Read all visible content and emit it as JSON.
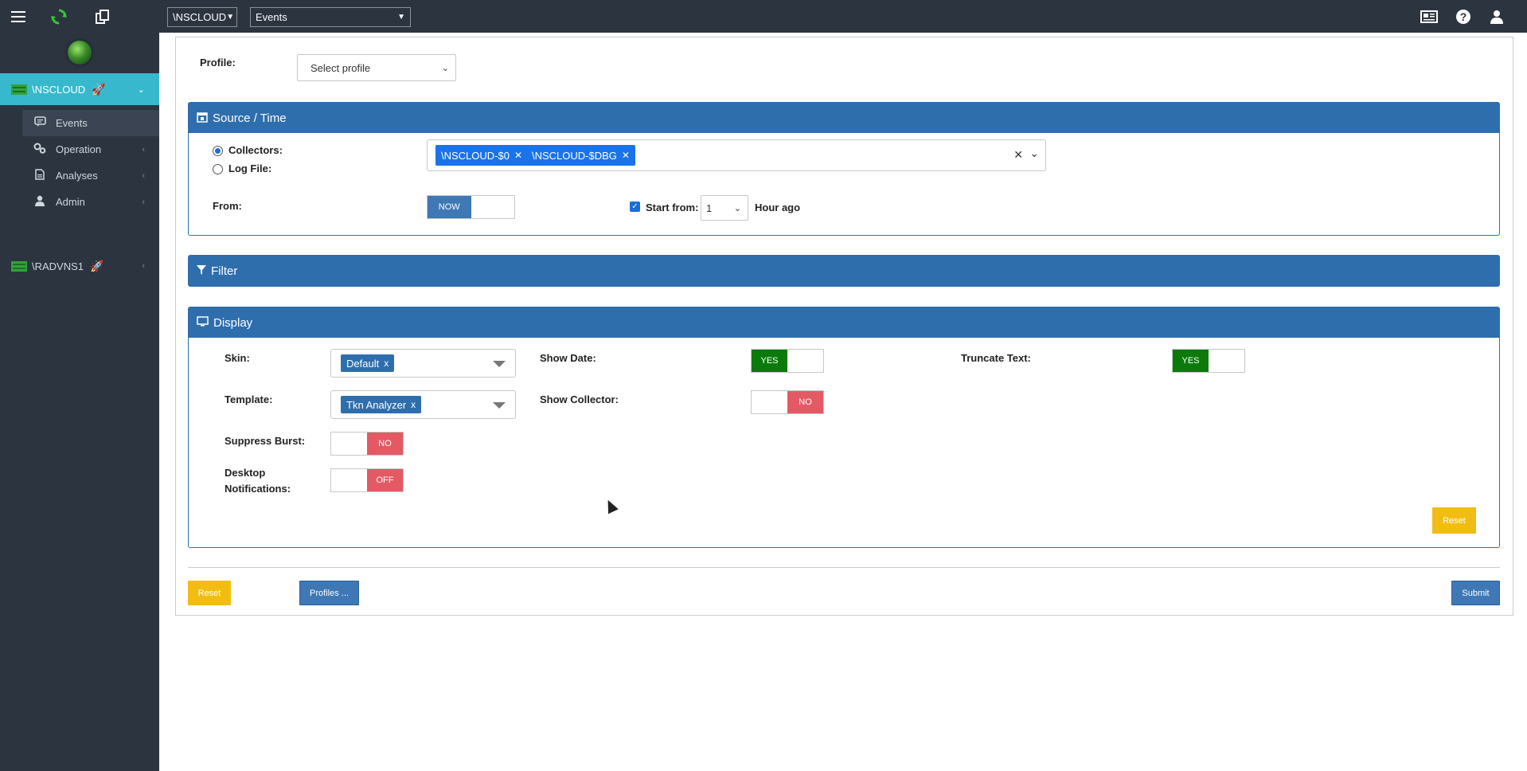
{
  "topbar": {
    "menu_icon": "hamburger-icon",
    "refresh_icon": "refresh-icon",
    "copy_icon": "copy-icon",
    "node_select": "\\NSCLOUD",
    "page_select": "Events",
    "news_icon": "newspaper-icon",
    "help_icon": "help-icon",
    "user_icon": "user-icon"
  },
  "sidebar": {
    "nodes": [
      {
        "label": "\\NSCLOUD",
        "active": true
      },
      {
        "label": "\\RADVNS1",
        "active": false
      }
    ],
    "items": [
      {
        "label": "Events",
        "icon": "comment-icon"
      },
      {
        "label": "Operation",
        "icon": "cogs-icon"
      },
      {
        "label": "Analyses",
        "icon": "document-icon"
      },
      {
        "label": "Admin",
        "icon": "user-icon"
      }
    ]
  },
  "profile": {
    "label": "Profile:",
    "placeholder": "Select profile"
  },
  "source_time": {
    "title": "Source / Time",
    "collectors_label": "Collectors:",
    "logfile_label": "Log File:",
    "tags": [
      "\\NSCLOUD-$0",
      "\\NSCLOUD-$DBG"
    ],
    "from_label": "From:",
    "now_label": "NOW",
    "start_from_label": "Start from:",
    "start_from_value": "1",
    "hour_ago": "Hour ago"
  },
  "filter": {
    "title": "Filter"
  },
  "display": {
    "title": "Display",
    "skin_label": "Skin:",
    "skin_value": "Default",
    "template_label": "Template:",
    "template_value": "Tkn Analyzer",
    "suppress_label": "Suppress Burst:",
    "suppress_value": "NO",
    "desktop_label_1": "Desktop",
    "desktop_label_2": "Notifications:",
    "desktop_value": "OFF",
    "show_date_label": "Show Date:",
    "show_date_value": "YES",
    "show_collector_label": "Show Collector:",
    "show_collector_value": "NO",
    "truncate_label": "Truncate Text:",
    "truncate_value": "YES",
    "reset_label": "Reset"
  },
  "footer": {
    "reset_label": "Reset",
    "profiles_label": "Profiles ...",
    "submit_label": "Submit"
  },
  "colors": {
    "topbar_bg": "#2c3440",
    "accent_teal": "#38b8cc",
    "panel_blue": "#2e6ead",
    "yes_green": "#0b7a0b",
    "no_red": "#e35a65",
    "reset_yellow": "#f2bd12"
  }
}
